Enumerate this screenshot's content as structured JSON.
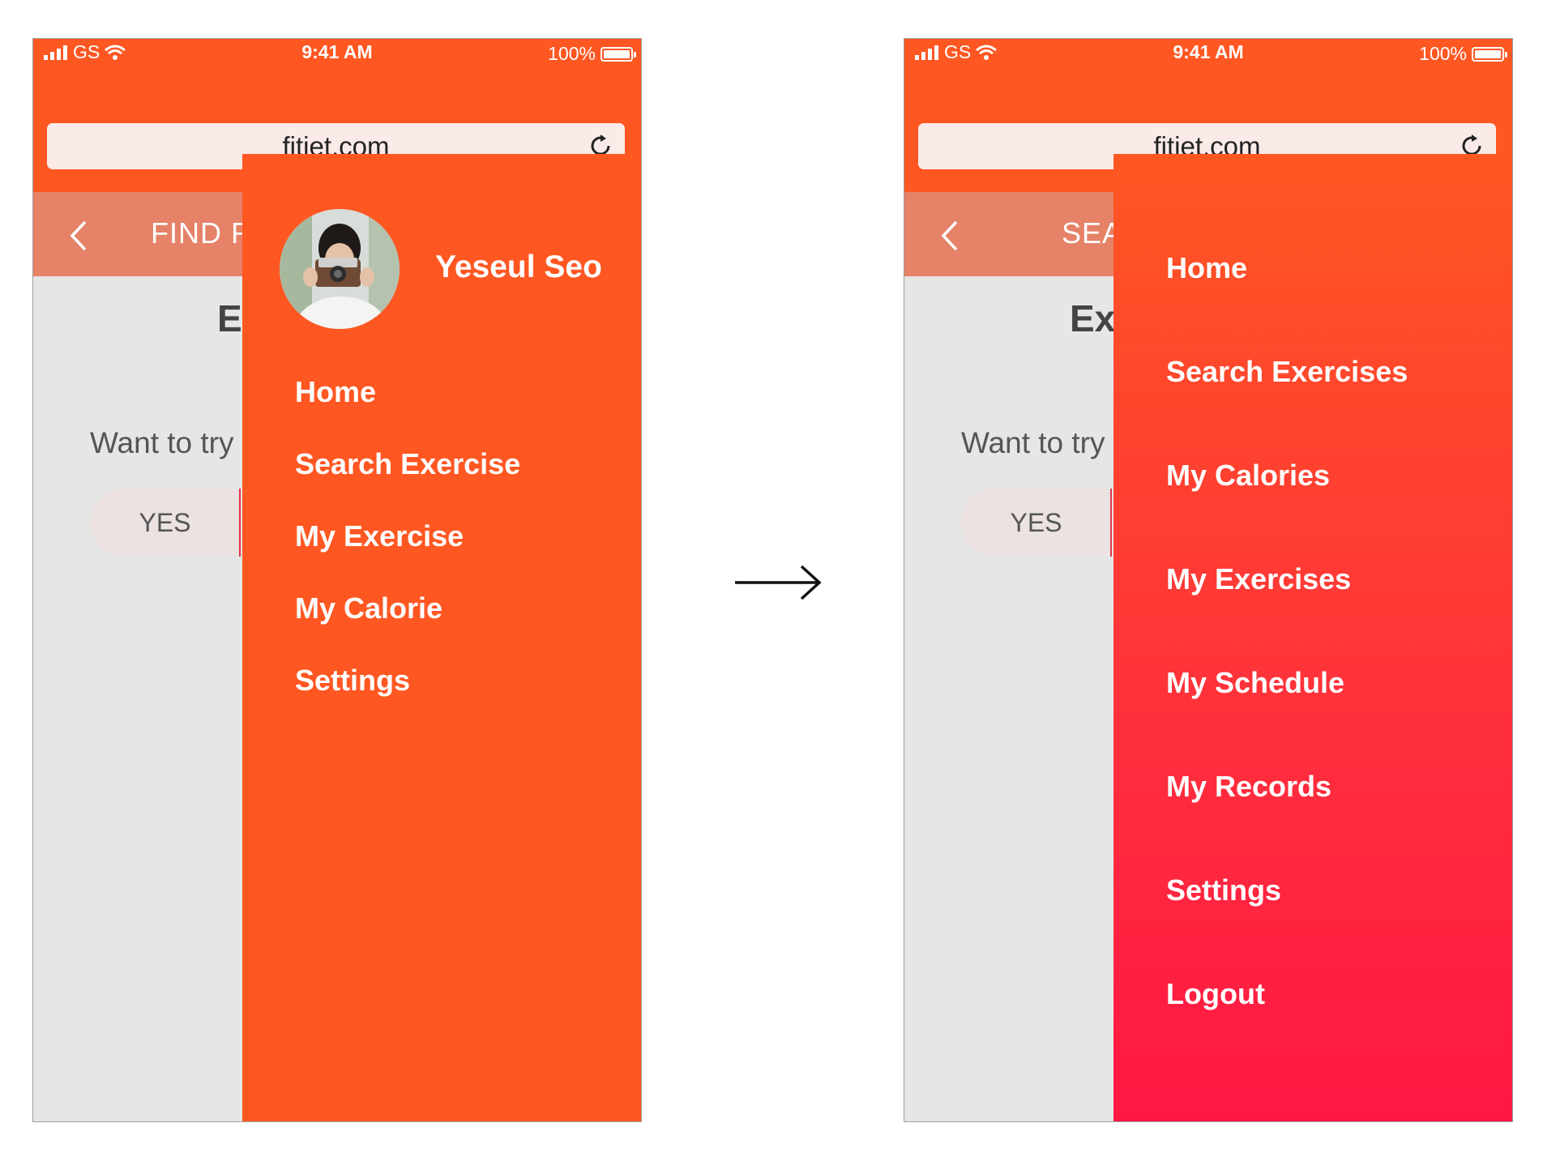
{
  "left_screen": {
    "status": {
      "carrier": "GS",
      "time": "9:41 AM",
      "battery": "100%"
    },
    "url": "fitjet.com",
    "header_title": "FIND R",
    "heading": "Ex",
    "question": "Want to try",
    "yes_label": "YES",
    "profile_name": "Yeseul Seo",
    "menu": [
      "Home",
      "Search Exercise",
      "My Exercise",
      "My Calorie",
      "Settings"
    ]
  },
  "right_screen": {
    "status": {
      "carrier": "GS",
      "time": "9:41 AM",
      "battery": "100%"
    },
    "url": "fitjet.com",
    "header_title": "SEA",
    "heading": "Ex",
    "question": "Want to try",
    "yes_label": "YES",
    "menu": [
      "Home",
      "Search Exercises",
      "My Calories",
      "My Exercises",
      "My Schedule",
      "My Records",
      "Settings",
      "Logout"
    ]
  },
  "icons": {
    "signal": "signal-bars-icon",
    "wifi": "wifi-icon",
    "battery": "battery-icon",
    "reload": "reload-icon",
    "back": "chevron-left-icon",
    "arrow": "arrow-right-icon"
  },
  "colors": {
    "accent_orange": "#ff5722",
    "gradient_end_red": "#ff1744",
    "header_salmon": "#e58267",
    "content_gray": "#e6e6e6"
  }
}
